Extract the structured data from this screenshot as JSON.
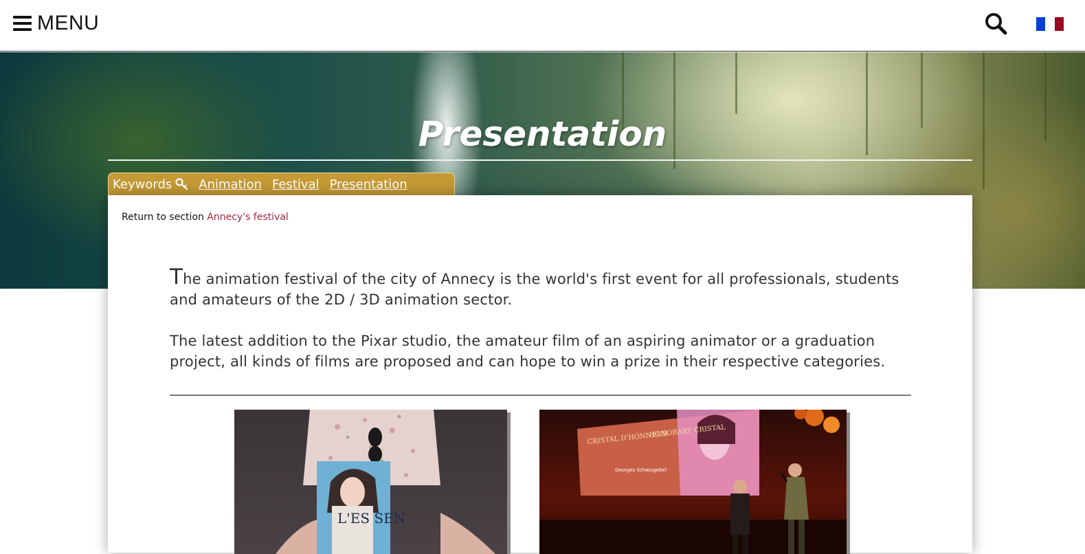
{
  "header": {
    "menu_label": "MENU",
    "search_icon": "search-icon",
    "language_flag": "french-flag-icon",
    "flag_colors": [
      "#0a3fd6",
      "#ffffff",
      "#9b0c23"
    ]
  },
  "hero": {
    "title": "Presentation"
  },
  "keywords": {
    "label": "Keywords",
    "icon": "key-icon",
    "items": [
      "Animation",
      "Festival",
      "Presentation"
    ],
    "tab_color": "#c59a35"
  },
  "content": {
    "return_prefix": "Return to section",
    "return_link": "Annecy's festival",
    "intro_first_letter": "T",
    "intro_rest": "he animation festival of the city of Annecy is the world's first event for all professionals, students and amateurs of the 2D / 3D animation sector.",
    "paragraph2": "The latest addition to the Pixar studio, the amateur film of an aspiring animator or a graduation project, all kinds of films are proposed and can hope to win a prize in their respective categories.",
    "photo2_screen_line1": "CRISTAL D'HONNEUR",
    "photo2_screen_line2": "HONORARY CRISTAL",
    "photo2_screen_name": "Georges Schwizgebel",
    "photo1_booklet_text": "L'ES SEN"
  }
}
